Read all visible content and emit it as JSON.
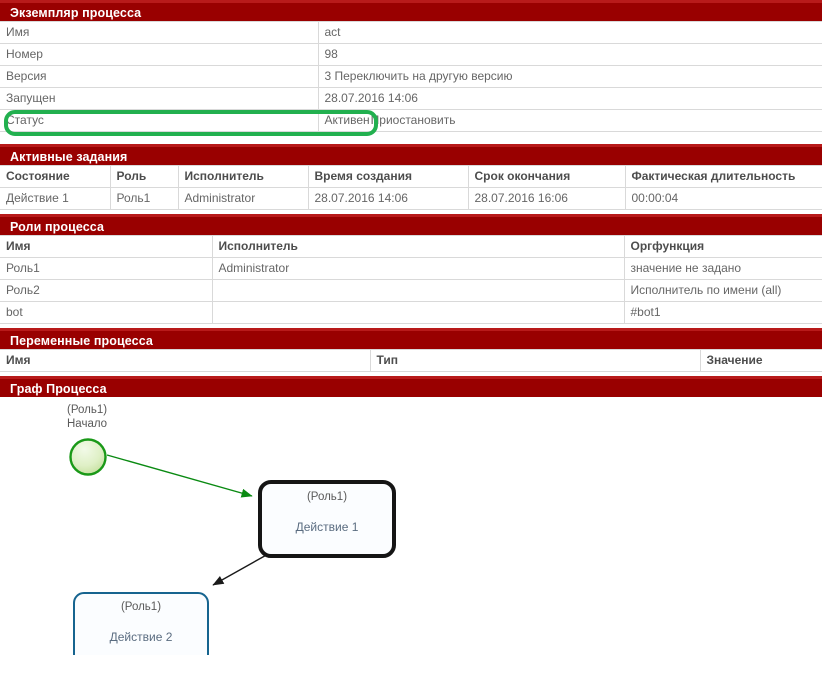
{
  "colors": {
    "header_bar": "#990000",
    "header_bar_top": "#b81a1a",
    "annotation_green": "#22b04f",
    "start_node_green": "#1a9918",
    "active_node_border": "#151515",
    "plain_node_border": "#16648f",
    "transition_green": "#0a8a12",
    "transition_black": "#1a1a1a"
  },
  "sections": {
    "instance": {
      "title": "Экземпляр процесса",
      "rows": [
        {
          "label": "Имя",
          "value": "act"
        },
        {
          "label": "Номер",
          "value": "98"
        },
        {
          "label": "Версия",
          "value": "3 Переключить на другую версию"
        },
        {
          "label": "Запущен",
          "value": "28.07.2016 14:06"
        }
      ],
      "status_row": {
        "label": "Статус",
        "value": "Активен",
        "action_label": "Приостановить"
      }
    },
    "active_tasks": {
      "title": "Активные задания",
      "columns": [
        "Состояние",
        "Роль",
        "Исполнитель",
        "Время создания",
        "Срок окончания",
        "Фактическая длительность"
      ],
      "rows": [
        [
          "Действие 1",
          "Роль1",
          "Administrator",
          "28.07.2016 14:06",
          "28.07.2016 16:06",
          "00:00:04"
        ]
      ]
    },
    "process_roles": {
      "title": "Роли процесса",
      "columns": [
        "Имя",
        "Исполнитель",
        "Оргфункция"
      ],
      "rows": [
        [
          "Роль1",
          "Administrator",
          "значение не задано"
        ],
        [
          "Роль2",
          "",
          "Исполнитель по имени (all)"
        ],
        [
          "bot",
          "",
          "#bot1"
        ]
      ]
    },
    "process_variables": {
      "title": "Переменные процесса",
      "columns": [
        "Имя",
        "Тип",
        "Значение"
      ],
      "rows": []
    },
    "process_graph": {
      "title": "Граф Процесса",
      "start_node": {
        "role": "(Роль1)",
        "name": "Начало"
      },
      "nodes": [
        {
          "role": "(Роль1)",
          "name": "Действие 1",
          "state": "active"
        },
        {
          "role": "(Роль1)",
          "name": "Действие 2",
          "state": "plain"
        }
      ]
    }
  }
}
